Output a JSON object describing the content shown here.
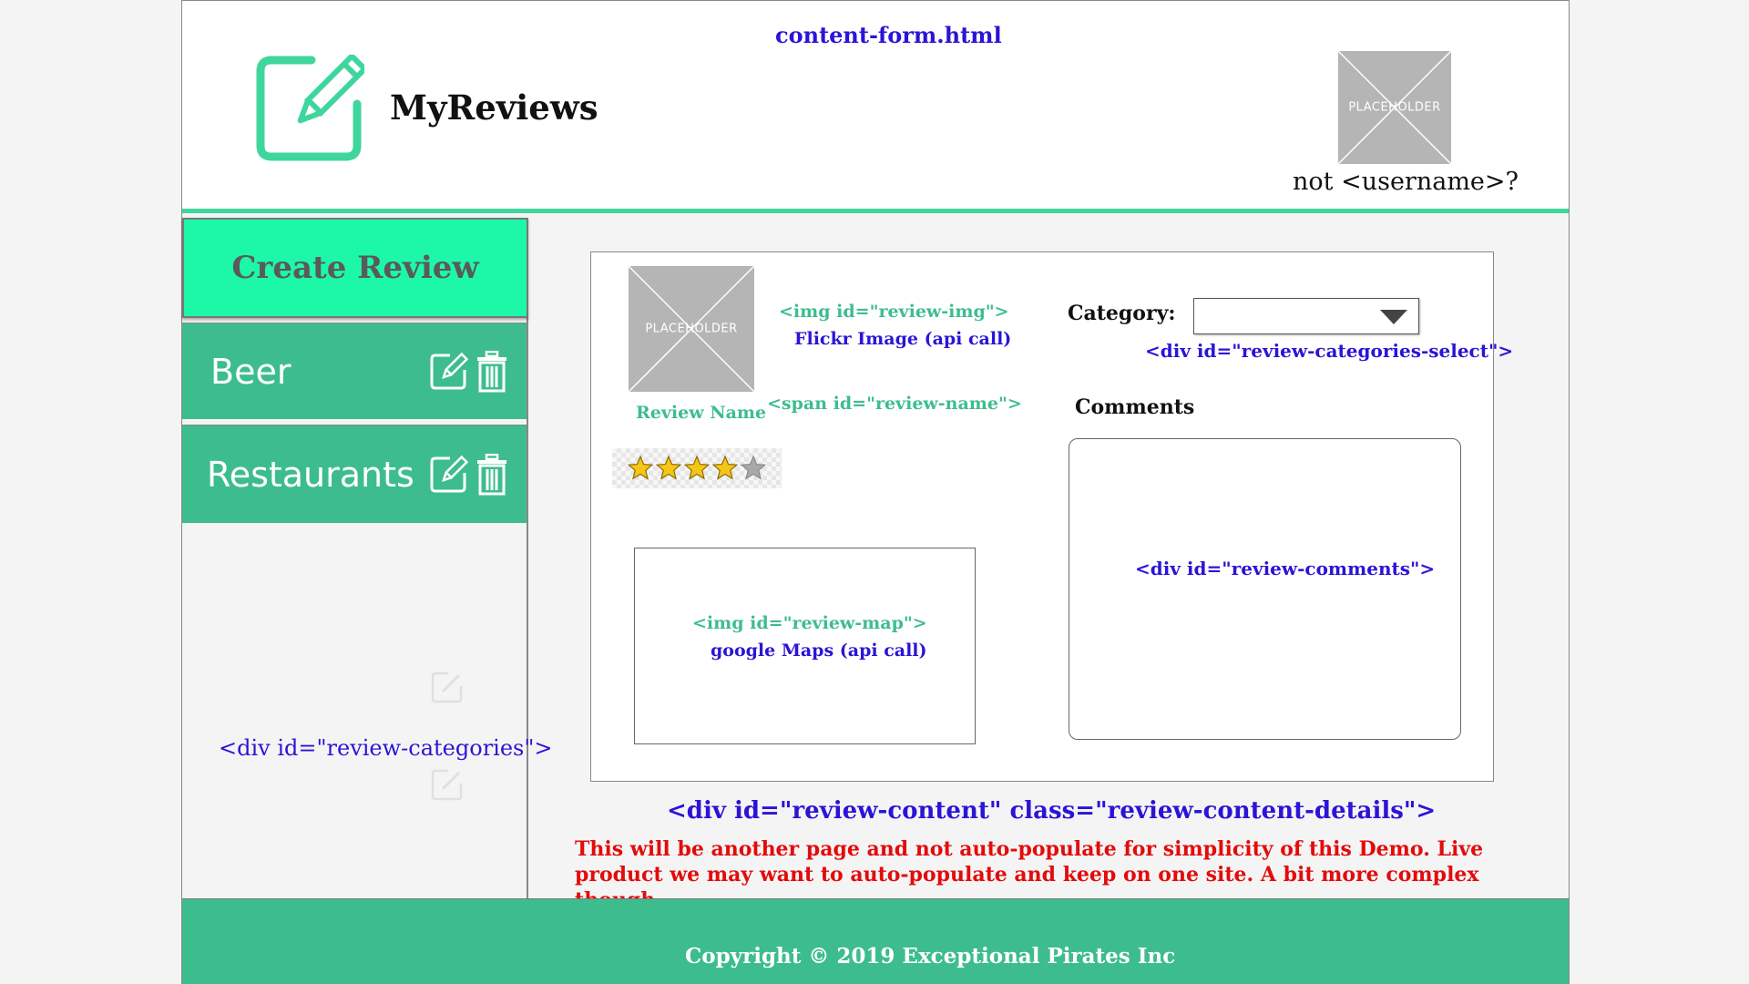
{
  "page": {
    "filename": "content-form.html"
  },
  "header": {
    "app_name": "MyReviews",
    "logo_icon": "edit-square-icon",
    "avatar_placeholder": "PLACEHOLDER",
    "logout_text": "not <username>?"
  },
  "sidebar": {
    "create_label": "Create Review",
    "categories": [
      {
        "label": "Beer",
        "edit_icon": "edit-icon",
        "delete_icon": "trash-icon"
      },
      {
        "label": "Restaurants",
        "edit_icon": "edit-icon",
        "delete_icon": "trash-icon"
      }
    ],
    "container_note": "<div id=\"review-categories\">"
  },
  "review": {
    "image_placeholder": "PLACEHOLDER",
    "image_note": "<img id=\"review-img\">",
    "image_source_note": "Flickr Image (api call)",
    "name_label": "Review Name",
    "name_note": "<span id=\"review-name\">",
    "rating": {
      "value": 4,
      "max": 5
    },
    "map_note": "<img id=\"review-map\">",
    "map_source_note": "google Maps (api call)",
    "category_label": "Category:",
    "category_value": "",
    "category_note": "<div id=\"review-categories-select\">",
    "comments_label": "Comments",
    "comments_note": "<div id=\"review-comments\">",
    "content_note": "<div id=\"review-content\" class=\"review-content-details\">"
  },
  "annotation": {
    "demo_note": "This will be another page and not auto-populate for simplicity of this Demo.  Live product we may want to auto-populate and keep on one site.  A bit more complex though"
  },
  "footer": {
    "copyright": "Copyright © 2019  Exceptional Pirates Inc"
  },
  "colors": {
    "accent_green": "#3fd69d",
    "bright_green": "#1cf8a8",
    "sidebar_green": "#3dbd8d",
    "note_blue": "#2a14d6",
    "note_red": "#e30b0b"
  }
}
